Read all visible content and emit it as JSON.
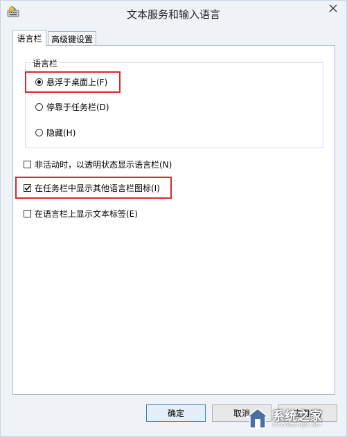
{
  "window": {
    "title": "文本服务和输入语言",
    "icon": "keyboard-language-icon",
    "close_icon": "close-icon"
  },
  "tabs": [
    {
      "label": "语言栏",
      "active": true
    },
    {
      "label": "高级键设置",
      "active": false
    }
  ],
  "language_bar_group": {
    "title": "语言栏",
    "options": [
      {
        "label": "悬浮于桌面上(F)",
        "checked": true
      },
      {
        "label": "停靠于任务栏(D)",
        "checked": false
      },
      {
        "label": "隐藏(H)",
        "checked": false
      }
    ]
  },
  "checkboxes": [
    {
      "label": "非活动时，以透明状态显示语言栏(N)",
      "checked": false
    },
    {
      "label": "在任务栏中显示其他语言栏图标(I)",
      "checked": true
    },
    {
      "label": "在语言栏上显示文本标签(E)",
      "checked": false
    }
  ],
  "buttons": {
    "ok": "确定",
    "cancel": "取消",
    "apply": "应用(A)"
  },
  "watermark": {
    "main": "系统之家",
    "sub": "XITONGZHIJIA.NET"
  },
  "colors": {
    "highlight": "#e0242a",
    "window_bg": "#eff3f8",
    "tab_border": "#a7b6c9"
  }
}
